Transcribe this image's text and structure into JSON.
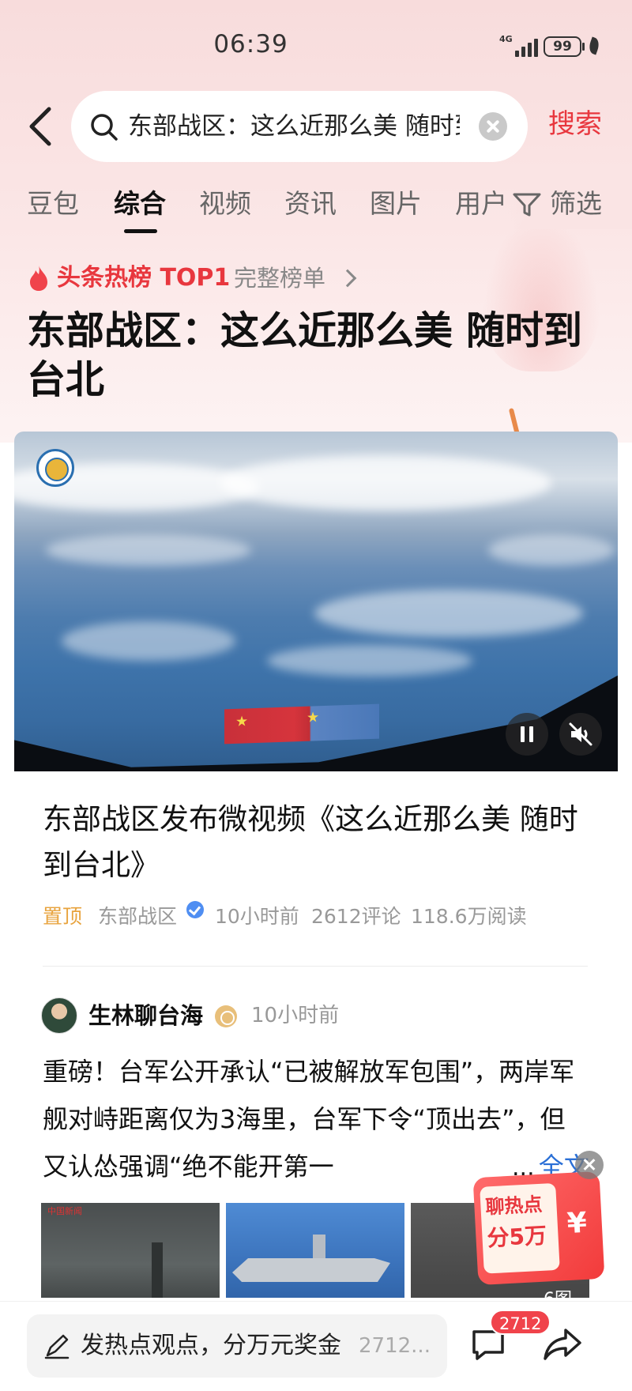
{
  "status_bar": {
    "time": "06:39",
    "network": "4G",
    "battery": "99"
  },
  "search": {
    "query": "东部战区：这么近那么美 随时到台北",
    "submit_label": "搜索"
  },
  "tabs": [
    {
      "label": "豆包"
    },
    {
      "label": "综合"
    },
    {
      "label": "视频"
    },
    {
      "label": "资讯"
    },
    {
      "label": "图片"
    },
    {
      "label": "用户"
    }
  ],
  "filter_label": "筛选",
  "hot": {
    "label": "头条热榜 TOP1",
    "list_label": "完整榜单"
  },
  "headline": "东部战区：这么近那么美 随时到台北",
  "article": {
    "title": "东部战区发布微视频《这么近那么美 随时到台北》",
    "pinned": "置顶",
    "source": "东部战区",
    "time": "10小时前",
    "comments": "2612评论",
    "reads": "118.6万阅读"
  },
  "post": {
    "author": "生林聊台海",
    "time": "10小时前",
    "body": "重磅！台军公开承认“已被解放军包围”，两岸军舰对峙距离仅为3海里，台军下令“顶出去”，但又认怂强调“绝不能开第一",
    "ellipsis": "...",
    "read_more": "全文",
    "thumb1_logo": "中国新闻",
    "image_count": "6图"
  },
  "promo": {
    "line1": "聊热点",
    "line2": "分5万",
    "symbol": "¥"
  },
  "bottom": {
    "comment_placeholder": "发热点观点，分万元奖金",
    "comment_count_text": "2712...",
    "comment_badge": "2712"
  },
  "colors": {
    "accent_red": "#e8373e",
    "link_blue": "#2a6fd6",
    "pinned_orange": "#e8a33d",
    "verified_blue": "#4f8ef2"
  }
}
